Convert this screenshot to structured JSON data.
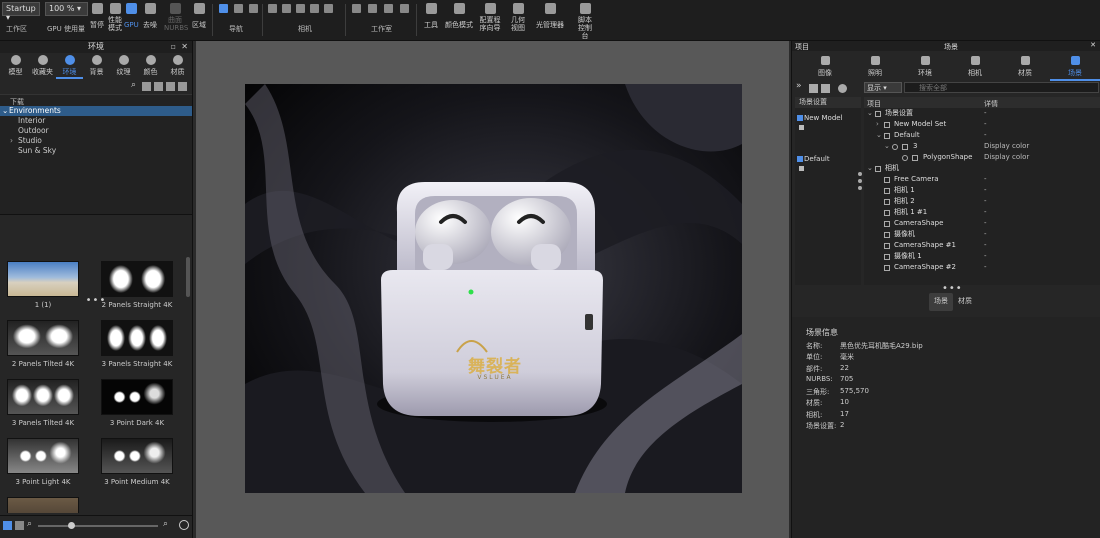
{
  "toolbar": {
    "workspace_select": "Startup",
    "workspace_label": "工作区",
    "zoom_select": "100 %",
    "gpu_usage_label": "GPU 使用量",
    "pause_label": "暂停",
    "perf_mode_label": "性能模式",
    "gpu_label": "GPU",
    "denoise_label": "去噪",
    "tess_nurbs_label": "曲面 NURBS",
    "region_label": "区域",
    "nav_group": "导航",
    "camera_group": "相机",
    "workspace_group": "工作室",
    "tools_label": "工具",
    "color_mode_label": "颜色模式",
    "config_wizard_label": "配置程序向导",
    "geometry_view_label": "几何视图",
    "light_manager_label": "光管理器",
    "script_console_label": "脚本控制台",
    "accent_color": "#4f8fe8"
  },
  "left_panel": {
    "title": "环境",
    "tabs": [
      {
        "label": "模型"
      },
      {
        "label": "收藏夹"
      },
      {
        "label": "环境"
      },
      {
        "label": "背景"
      },
      {
        "label": "纹理"
      },
      {
        "label": "颜色"
      },
      {
        "label": "材质"
      }
    ],
    "tree_header": "下载",
    "tree": [
      {
        "label": "Environments"
      },
      {
        "label": "Interior"
      },
      {
        "label": "Outdoor"
      },
      {
        "label": "Studio"
      },
      {
        "label": "Sun & Sky"
      }
    ],
    "thumbnails": [
      {
        "label": "1 (1)"
      },
      {
        "label": "2 Panels Straight 4K"
      },
      {
        "label": "2 Panels Tilted 4K"
      },
      {
        "label": "3 Panels Straight 4K"
      },
      {
        "label": "3 Panels Tilted 4K"
      },
      {
        "label": "3 Point Dark 4K"
      },
      {
        "label": "3 Point Light 4K"
      },
      {
        "label": "3 Point Medium 4K"
      }
    ]
  },
  "render": {
    "logo_text": "舞裂者",
    "logo_subtext": "VSLUEA",
    "led_color": "#2ee04a"
  },
  "right_panel": {
    "project_label": "项目",
    "title": "场景",
    "tabs": [
      {
        "label": "图像"
      },
      {
        "label": "照明"
      },
      {
        "label": "环境"
      },
      {
        "label": "相机"
      },
      {
        "label": "材质"
      },
      {
        "label": "场景"
      }
    ],
    "filter_value": "显示",
    "search_placeholder": "搜索全部",
    "sets_header": "场景设置",
    "sets": [
      {
        "label": "New Model"
      },
      {
        "label": "Default"
      }
    ],
    "tree_col_item": "项目",
    "tree_col_detail": "详情",
    "tree_rows": [
      {
        "name": "场景设置",
        "detail": "-"
      },
      {
        "name": "New Model Set",
        "detail": "-"
      },
      {
        "name": "Default",
        "detail": "-"
      },
      {
        "name": "3",
        "detail": "Display color"
      },
      {
        "name": "PolygonShape",
        "detail": "Display color"
      },
      {
        "name": "相机",
        "detail": ""
      },
      {
        "name": "Free Camera",
        "detail": "-"
      },
      {
        "name": "相机 1",
        "detail": "-"
      },
      {
        "name": "相机 2",
        "detail": "-"
      },
      {
        "name": "相机 1 #1",
        "detail": "-"
      },
      {
        "name": "CameraShape",
        "detail": "-"
      },
      {
        "name": "摄像机",
        "detail": "-"
      },
      {
        "name": "CameraShape #1",
        "detail": "-"
      },
      {
        "name": "摄像机 1",
        "detail": "-"
      },
      {
        "name": "CameraShape #2",
        "detail": "-"
      }
    ],
    "subtabs": [
      {
        "label": "场景"
      },
      {
        "label": "材质"
      }
    ],
    "info_title": "场景信息",
    "info": [
      {
        "key": "名称:",
        "value": "黑色优先耳机酷毛A29.bip"
      },
      {
        "key": "单位:",
        "value": "毫米"
      },
      {
        "key": "部件:",
        "value": "22"
      },
      {
        "key": "NURBS:",
        "value": "705"
      },
      {
        "key": "三角形:",
        "value": "575,570"
      },
      {
        "key": "材质:",
        "value": "10"
      },
      {
        "key": "相机:",
        "value": "17"
      },
      {
        "key": "场景设置:",
        "value": "2"
      }
    ]
  }
}
